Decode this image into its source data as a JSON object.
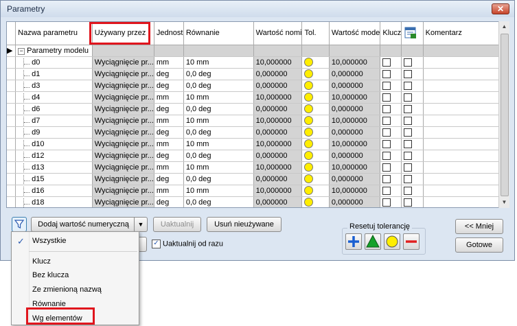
{
  "window": {
    "title": "Parametry",
    "close_glyph": "✕"
  },
  "grid": {
    "columns": [
      "Nazwa parametru",
      "Używany przez",
      "Jednost",
      "Równanie",
      "Wartość nomi",
      "Tol.",
      "Wartość mode",
      "Klucz",
      "",
      "Komentarz"
    ],
    "group_label": "Parametry modelu",
    "rows": [
      {
        "name": "d0",
        "used_by": "Wyciągnięcie pr...",
        "unit": "mm",
        "equation": "10 mm",
        "nominal": "10,000000",
        "model": "10,000000"
      },
      {
        "name": "d1",
        "used_by": "Wyciągnięcie pr...",
        "unit": "deg",
        "equation": "0,0 deg",
        "nominal": "0,000000",
        "model": "0,000000"
      },
      {
        "name": "d3",
        "used_by": "Wyciągnięcie pr...",
        "unit": "deg",
        "equation": "0,0 deg",
        "nominal": "0,000000",
        "model": "0,000000"
      },
      {
        "name": "d4",
        "used_by": "Wyciągnięcie pr...",
        "unit": "mm",
        "equation": "10 mm",
        "nominal": "10,000000",
        "model": "10,000000"
      },
      {
        "name": "d6",
        "used_by": "Wyciągnięcie pr...",
        "unit": "deg",
        "equation": "0,0 deg",
        "nominal": "0,000000",
        "model": "0,000000"
      },
      {
        "name": "d7",
        "used_by": "Wyciągnięcie pr...",
        "unit": "mm",
        "equation": "10 mm",
        "nominal": "10,000000",
        "model": "10,000000"
      },
      {
        "name": "d9",
        "used_by": "Wyciągnięcie pr...",
        "unit": "deg",
        "equation": "0,0 deg",
        "nominal": "0,000000",
        "model": "0,000000"
      },
      {
        "name": "d10",
        "used_by": "Wyciągnięcie pr...",
        "unit": "mm",
        "equation": "10 mm",
        "nominal": "10,000000",
        "model": "10,000000"
      },
      {
        "name": "d12",
        "used_by": "Wyciągnięcie pr...",
        "unit": "deg",
        "equation": "0,0 deg",
        "nominal": "0,000000",
        "model": "0,000000"
      },
      {
        "name": "d13",
        "used_by": "Wyciągnięcie pr...",
        "unit": "mm",
        "equation": "10 mm",
        "nominal": "10,000000",
        "model": "10,000000"
      },
      {
        "name": "d15",
        "used_by": "Wyciągnięcie pr...",
        "unit": "deg",
        "equation": "0,0 deg",
        "nominal": "0,000000",
        "model": "0,000000"
      },
      {
        "name": "d16",
        "used_by": "Wyciągnięcie pr...",
        "unit": "mm",
        "equation": "10 mm",
        "nominal": "10,000000",
        "model": "10,000000"
      },
      {
        "name": "d18",
        "used_by": "Wyciągnięcie pr...",
        "unit": "deg",
        "equation": "0,0 deg",
        "nominal": "0,000000",
        "model": "0,000000"
      }
    ]
  },
  "toolbar": {
    "add_numeric_label": "Dodaj wartość numeryczną",
    "update_label": "Uaktualnij",
    "remove_unused_label": "Usuń nieużywane",
    "update_immediately_label": "Uaktualnij od razu",
    "reset_tolerance_label": "Resetuj tolerancję",
    "less_label": "<< Mniej",
    "done_label": "Gotowe"
  },
  "filter_menu": {
    "items": [
      "Wszystkie",
      "Klucz",
      "Bez klucza",
      "Ze zmienioną nazwą",
      "Równanie",
      "Wg elementów"
    ],
    "checked": "Wszystkie"
  },
  "colors": {
    "highlight": "#e0151d",
    "tol_circle": "#ffee00",
    "tol_plus": "#1a5fd1",
    "tol_triangle": "#15a12a",
    "tol_minus": "#e02020"
  }
}
